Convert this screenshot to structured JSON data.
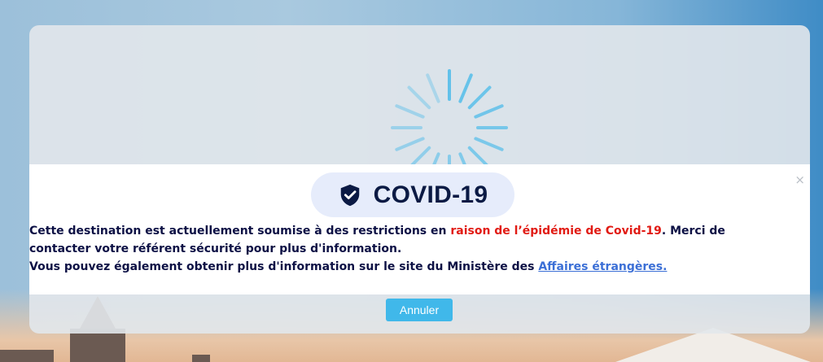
{
  "modal": {
    "badge_title": "COVID-19",
    "icon": "shield-check-icon",
    "close_glyph": "×",
    "message": {
      "part1": "Cette destination est actuellement soumise à des restrictions en ",
      "highlight": "raison de l’épidémie de Covid-19",
      "part2": ". Merci de contacter votre référent sécurité pour plus d'information.",
      "line2_prefix": "Vous pouvez également obtenir plus d'information sur le site du Ministère des ",
      "link_text": "Affaires étrangères."
    },
    "cancel_label": "Annuler"
  },
  "colors": {
    "highlight": "#e11b14",
    "link": "#3b6fd6",
    "button": "#40b8ea",
    "spinner": "#5cc0ea",
    "badge_bg": "#e6ecfb",
    "title_text": "#0b1a44"
  }
}
